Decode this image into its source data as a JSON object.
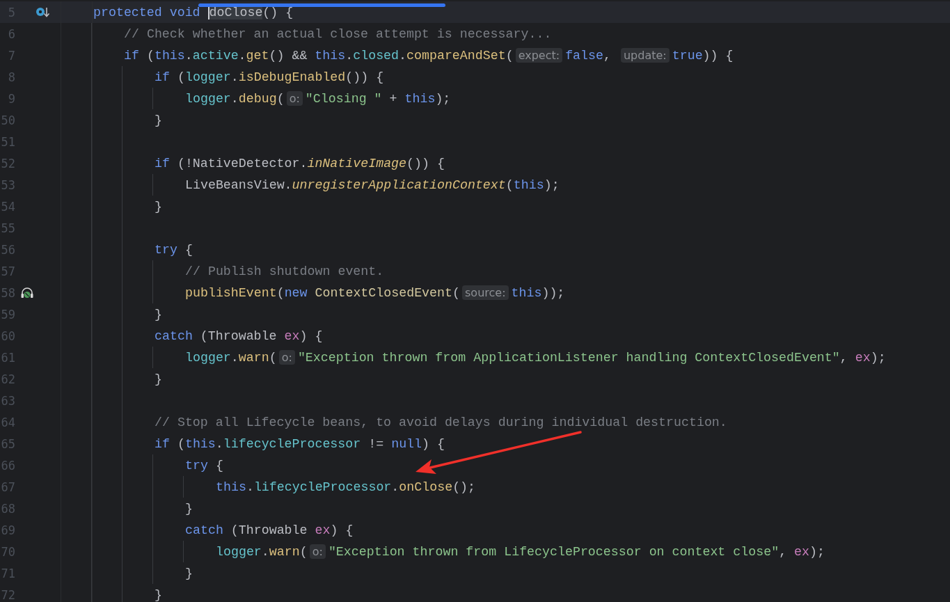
{
  "editor": {
    "lines": [
      {
        "number": "5",
        "current": true,
        "override_marker": true,
        "segments": [
          {
            "kind": "keyword",
            "text": "protected void "
          },
          {
            "kind": "method_decl",
            "text": "doClose",
            "caret": true
          },
          {
            "kind": "plain",
            "text": "() {"
          }
        ],
        "children": [
          {
            "number": "6",
            "current": false,
            "segments": [
              {
                "kind": "comment",
                "text": "// Check whether an actual close attempt is necessary..."
              }
            ]
          },
          {
            "number": "7",
            "current": false,
            "segments": [
              {
                "kind": "keyword",
                "text": "if "
              },
              {
                "kind": "plain",
                "text": "("
              },
              {
                "kind": "keyword",
                "text": "this"
              },
              {
                "kind": "plain",
                "text": "."
              },
              {
                "kind": "field",
                "text": "active"
              },
              {
                "kind": "plain",
                "text": "."
              },
              {
                "kind": "method",
                "text": "get"
              },
              {
                "kind": "plain",
                "text": "() && "
              },
              {
                "kind": "keyword",
                "text": "this"
              },
              {
                "kind": "plain",
                "text": "."
              },
              {
                "kind": "field",
                "text": "closed"
              },
              {
                "kind": "plain",
                "text": "."
              },
              {
                "kind": "method",
                "text": "compareAndSet"
              },
              {
                "kind": "plain",
                "text": "("
              },
              {
                "kind": "hint",
                "text": "expect:"
              },
              {
                "kind": "keyword",
                "text": "false"
              },
              {
                "kind": "plain",
                "text": ", "
              },
              {
                "kind": "hint",
                "text": "update:"
              },
              {
                "kind": "keyword",
                "text": "true"
              },
              {
                "kind": "plain",
                "text": ")) {"
              }
            ],
            "children": [
              {
                "number": "8",
                "current": false,
                "segments": [
                  {
                    "kind": "keyword",
                    "text": "if "
                  },
                  {
                    "kind": "plain",
                    "text": "("
                  },
                  {
                    "kind": "field",
                    "text": "logger"
                  },
                  {
                    "kind": "plain",
                    "text": "."
                  },
                  {
                    "kind": "method",
                    "text": "isDebugEnabled"
                  },
                  {
                    "kind": "plain",
                    "text": "()) {"
                  }
                ],
                "children": [
                  {
                    "number": "9",
                    "current": false,
                    "segments": [
                      {
                        "kind": "field",
                        "text": "logger"
                      },
                      {
                        "kind": "plain",
                        "text": "."
                      },
                      {
                        "kind": "method",
                        "text": "debug"
                      },
                      {
                        "kind": "plain",
                        "text": "("
                      },
                      {
                        "kind": "hint",
                        "text": "o:"
                      },
                      {
                        "kind": "string",
                        "text": "\"Closing \""
                      },
                      {
                        "kind": "plain",
                        "text": " + "
                      },
                      {
                        "kind": "keyword",
                        "text": "this"
                      },
                      {
                        "kind": "plain",
                        "text": ");"
                      }
                    ]
                  }
                ]
              },
              {
                "number": "50",
                "current": false,
                "segments": [
                  {
                    "kind": "plain",
                    "text": "}"
                  }
                ]
              },
              {
                "number": "51",
                "current": false
              },
              {
                "number": "52",
                "current": false,
                "segments": [
                  {
                    "kind": "keyword",
                    "text": "if "
                  },
                  {
                    "kind": "plain",
                    "text": "(!NativeDetector."
                  },
                  {
                    "kind": "static_method",
                    "text": "inNativeImage"
                  },
                  {
                    "kind": "plain",
                    "text": "()) {"
                  }
                ],
                "children": [
                  {
                    "number": "53",
                    "current": false,
                    "segments": [
                      {
                        "kind": "plain",
                        "text": "LiveBeansView."
                      },
                      {
                        "kind": "static_method",
                        "text": "unregisterApplicationContext"
                      },
                      {
                        "kind": "plain",
                        "text": "("
                      },
                      {
                        "kind": "keyword",
                        "text": "this"
                      },
                      {
                        "kind": "plain",
                        "text": ");"
                      }
                    ]
                  }
                ]
              },
              {
                "number": "54",
                "current": false,
                "segments": [
                  {
                    "kind": "plain",
                    "text": "}"
                  }
                ]
              },
              {
                "number": "55",
                "current": false
              },
              {
                "number": "56",
                "current": false,
                "segments": [
                  {
                    "kind": "keyword",
                    "text": "try"
                  },
                  {
                    "kind": "plain",
                    "text": " {"
                  }
                ],
                "children": [
                  {
                    "number": "57",
                    "current": false,
                    "segments": [
                      {
                        "kind": "comment",
                        "text": "// Publish shutdown event."
                      }
                    ]
                  },
                  {
                    "number": "58",
                    "current": false,
                    "listener_marker": true,
                    "segments": [
                      {
                        "kind": "method",
                        "text": "publishEvent"
                      },
                      {
                        "kind": "plain",
                        "text": "("
                      },
                      {
                        "kind": "keyword",
                        "text": "new "
                      },
                      {
                        "kind": "class",
                        "text": "ContextClosedEvent"
                      },
                      {
                        "kind": "plain",
                        "text": "("
                      },
                      {
                        "kind": "hint",
                        "text": "source:"
                      },
                      {
                        "kind": "keyword",
                        "text": "this"
                      },
                      {
                        "kind": "plain",
                        "text": "));"
                      }
                    ]
                  }
                ]
              },
              {
                "number": "59",
                "current": false,
                "segments": [
                  {
                    "kind": "plain",
                    "text": "}"
                  }
                ]
              },
              {
                "number": "60",
                "current": false,
                "segments": [
                  {
                    "kind": "keyword",
                    "text": "catch"
                  },
                  {
                    "kind": "plain",
                    "text": " (Throwable "
                  },
                  {
                    "kind": "param",
                    "text": "ex"
                  },
                  {
                    "kind": "plain",
                    "text": ") {"
                  }
                ],
                "children": [
                  {
                    "number": "61",
                    "current": false,
                    "segments": [
                      {
                        "kind": "field",
                        "text": "logger"
                      },
                      {
                        "kind": "plain",
                        "text": "."
                      },
                      {
                        "kind": "method",
                        "text": "warn"
                      },
                      {
                        "kind": "plain",
                        "text": "("
                      },
                      {
                        "kind": "hint",
                        "text": "o:"
                      },
                      {
                        "kind": "string",
                        "text": "\"Exception thrown from ApplicationListener handling ContextClosedEvent\""
                      },
                      {
                        "kind": "plain",
                        "text": ", "
                      },
                      {
                        "kind": "param",
                        "text": "ex"
                      },
                      {
                        "kind": "plain",
                        "text": ");"
                      }
                    ]
                  }
                ]
              },
              {
                "number": "62",
                "current": false,
                "segments": [
                  {
                    "kind": "plain",
                    "text": "}"
                  }
                ]
              },
              {
                "number": "63",
                "current": false
              },
              {
                "number": "64",
                "current": false,
                "segments": [
                  {
                    "kind": "comment",
                    "text": "// Stop all Lifecycle beans, to avoid delays during individual destruction."
                  }
                ]
              },
              {
                "number": "65",
                "current": false,
                "segments": [
                  {
                    "kind": "keyword",
                    "text": "if "
                  },
                  {
                    "kind": "plain",
                    "text": "("
                  },
                  {
                    "kind": "keyword",
                    "text": "this"
                  },
                  {
                    "kind": "plain",
                    "text": "."
                  },
                  {
                    "kind": "field",
                    "text": "lifecycleProcessor"
                  },
                  {
                    "kind": "plain",
                    "text": " != "
                  },
                  {
                    "kind": "keyword",
                    "text": "null"
                  },
                  {
                    "kind": "plain",
                    "text": ") {"
                  }
                ],
                "children": [
                  {
                    "number": "66",
                    "current": false,
                    "segments": [
                      {
                        "kind": "keyword",
                        "text": "try"
                      },
                      {
                        "kind": "plain",
                        "text": " {"
                      }
                    ],
                    "children": [
                      {
                        "number": "67",
                        "current": false,
                        "segments": [
                          {
                            "kind": "keyword",
                            "text": "this"
                          },
                          {
                            "kind": "plain",
                            "text": "."
                          },
                          {
                            "kind": "field",
                            "text": "lifecycleProcessor"
                          },
                          {
                            "kind": "plain",
                            "text": "."
                          },
                          {
                            "kind": "method",
                            "text": "onClose"
                          },
                          {
                            "kind": "plain",
                            "text": "();"
                          }
                        ]
                      }
                    ]
                  },
                  {
                    "number": "68",
                    "current": false,
                    "segments": [
                      {
                        "kind": "plain",
                        "text": "}"
                      }
                    ]
                  },
                  {
                    "number": "69",
                    "current": false,
                    "segments": [
                      {
                        "kind": "keyword",
                        "text": "catch"
                      },
                      {
                        "kind": "plain",
                        "text": " (Throwable "
                      },
                      {
                        "kind": "param",
                        "text": "ex"
                      },
                      {
                        "kind": "plain",
                        "text": ") {"
                      }
                    ],
                    "children": [
                      {
                        "number": "70",
                        "current": false,
                        "segments": [
                          {
                            "kind": "field",
                            "text": "logger"
                          },
                          {
                            "kind": "plain",
                            "text": "."
                          },
                          {
                            "kind": "method",
                            "text": "warn"
                          },
                          {
                            "kind": "plain",
                            "text": "("
                          },
                          {
                            "kind": "hint",
                            "text": "o:"
                          },
                          {
                            "kind": "string",
                            "text": "\"Exception thrown from LifecycleProcessor on context close\""
                          },
                          {
                            "kind": "plain",
                            "text": ", "
                          },
                          {
                            "kind": "param",
                            "text": "ex"
                          },
                          {
                            "kind": "plain",
                            "text": ");"
                          }
                        ]
                      }
                    ]
                  },
                  {
                    "number": "71",
                    "current": false,
                    "segments": [
                      {
                        "kind": "plain",
                        "text": "}"
                      }
                    ]
                  }
                ]
              },
              {
                "number": "72",
                "current": false,
                "segments": [
                  {
                    "kind": "plain",
                    "text": "}"
                  }
                ]
              }
            ]
          }
        ]
      }
    ]
  }
}
